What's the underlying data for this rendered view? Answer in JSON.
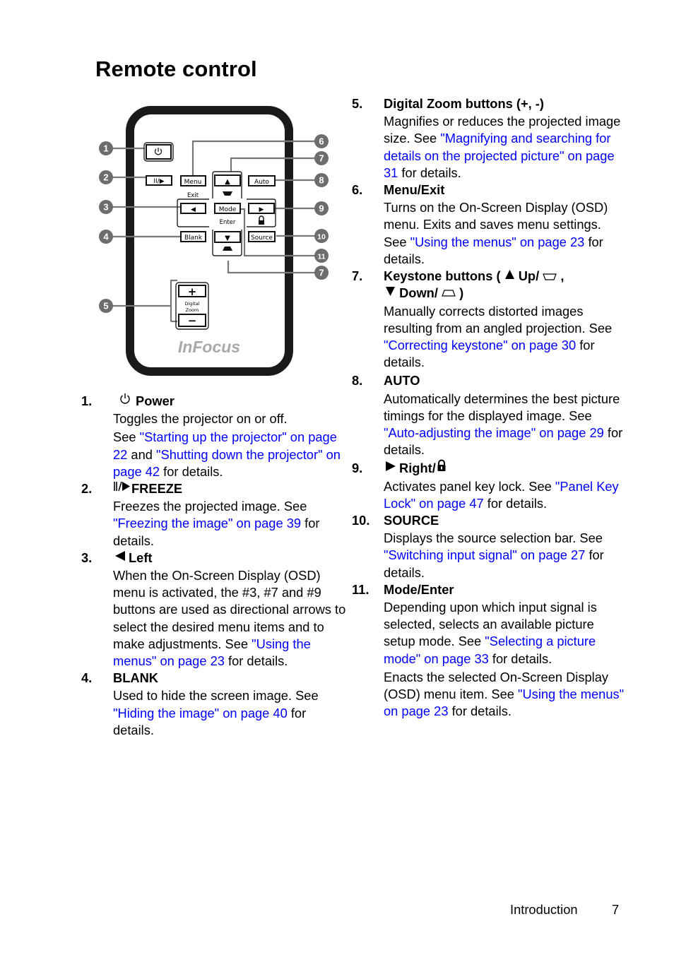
{
  "page": {
    "title": "Remote control",
    "footer": {
      "section": "Introduction",
      "page_number": "7"
    }
  },
  "diagram": {
    "brand": "InFocus",
    "buttons": {
      "power": "power-symbol",
      "freeze": "II/▶",
      "menu": "Menu",
      "exit": "Exit",
      "up": "▲",
      "auto": "Auto",
      "left": "◀",
      "mode": "Mode",
      "enter": "Enter",
      "right": "▶",
      "blank": "Blank",
      "down": "▼",
      "source": "Source",
      "zoom_in": "+",
      "zoom_label_1": "Digital",
      "zoom_label_2": "Zoom",
      "zoom_out": "−"
    },
    "callouts": [
      "1",
      "2",
      "3",
      "4",
      "5",
      "6",
      "7",
      "8",
      "9",
      "10",
      "11",
      "7"
    ],
    "colors": {
      "body": "#1a1a1a",
      "callout": "#6d6d6d",
      "brand": "#a9a9a9"
    }
  },
  "items": [
    {
      "number": "1.",
      "icon": "power-icon",
      "heading": "Power",
      "paragraphs": [
        {
          "parts": [
            {
              "text": "Toggles the projector on or off."
            }
          ]
        },
        {
          "parts": [
            {
              "text": "See "
            },
            {
              "text": "\"Starting up the projector\" on page 22",
              "link": true
            },
            {
              "text": " and "
            },
            {
              "text": "\"Shutting down the projector\" on page 42",
              "link": true
            },
            {
              "text": " for details."
            }
          ]
        }
      ]
    },
    {
      "number": "2.",
      "icon": "freeze-icon",
      "heading": "FREEZE",
      "paragraphs": [
        {
          "parts": [
            {
              "text": "Freezes the projected image. See "
            },
            {
              "text": "\"Freezing the image\" on page 39",
              "link": true
            },
            {
              "text": " for details."
            }
          ]
        }
      ]
    },
    {
      "number": "3.",
      "icon": "left-arrow-icon",
      "heading": "Left",
      "paragraphs": [
        {
          "parts": [
            {
              "text": "When the On-Screen Display (OSD) menu is activated, the #3, #7 and #9 buttons are used as directional arrows to select the desired menu items and to make adjustments. See "
            },
            {
              "text": "\"Using the menus\" on page 23",
              "link": true
            },
            {
              "text": " for details."
            }
          ]
        }
      ]
    },
    {
      "number": "4.",
      "heading": "BLANK",
      "paragraphs": [
        {
          "parts": [
            {
              "text": "Used to hide the screen image. See "
            },
            {
              "text": "\"Hiding the image\" on page 40",
              "link": true
            },
            {
              "text": " for details."
            }
          ]
        }
      ]
    },
    {
      "number": "5.",
      "heading": "Digital Zoom buttons (+, -)",
      "paragraphs": [
        {
          "parts": [
            {
              "text": "Magnifies or reduces the projected image size. See "
            },
            {
              "text": "\"Magnifying and searching for details on the projected picture\" on page 31",
              "link": true
            },
            {
              "text": " for details."
            }
          ]
        }
      ]
    },
    {
      "number": "6.",
      "heading": "Menu/Exit",
      "paragraphs": [
        {
          "parts": [
            {
              "text": "Turns on the On-Screen Display (OSD) menu. Exits and saves menu settings. See "
            },
            {
              "text": "\"Using the menus\" on page 23",
              "link": true
            },
            {
              "text": " for details."
            }
          ]
        }
      ]
    },
    {
      "number": "7.",
      "heading_parts": [
        "Keystone buttons (",
        "Up/",
        ",",
        "Down/",
        ")"
      ],
      "heading_icons": [
        "up-arrow-icon",
        "keystone-up-icon",
        "down-arrow-icon",
        "keystone-down-icon"
      ],
      "paragraphs": [
        {
          "parts": [
            {
              "text": "Manually corrects distorted images resulting from an angled projection. See "
            },
            {
              "text": "\"Correcting keystone\" on page 30",
              "link": true
            },
            {
              "text": " for details."
            }
          ]
        }
      ]
    },
    {
      "number": "8.",
      "heading": "AUTO",
      "paragraphs": [
        {
          "parts": [
            {
              "text": "Automatically determines the best picture timings for the displayed image. See "
            },
            {
              "text": "\"Auto-adjusting the image\" on page 29",
              "link": true
            },
            {
              "text": " for details."
            }
          ]
        }
      ]
    },
    {
      "number": "9.",
      "icon": "right-arrow-icon",
      "heading": "Right/",
      "heading_suffix_icon": "lock-icon",
      "paragraphs": [
        {
          "parts": [
            {
              "text": "Activates panel key lock. See "
            },
            {
              "text": "\"Panel Key Lock\" on page 47",
              "link": true
            },
            {
              "text": " for details."
            }
          ]
        }
      ]
    },
    {
      "number": "10.",
      "heading": "SOURCE",
      "paragraphs": [
        {
          "parts": [
            {
              "text": "Displays the source selection bar. See "
            },
            {
              "text": "\"Switching input signal\" on page 27",
              "link": true
            },
            {
              "text": " for details."
            }
          ]
        }
      ]
    },
    {
      "number": "11.",
      "heading": "Mode/Enter",
      "paragraphs": [
        {
          "parts": [
            {
              "text": "Depending upon which input signal is selected, selects an available picture setup mode. See "
            },
            {
              "text": "\"Selecting a picture mode\" on page 33",
              "link": true
            },
            {
              "text": " for details."
            }
          ]
        },
        {
          "parts": [
            {
              "text": "Enacts the selected On-Screen Display (OSD) menu item. See "
            },
            {
              "text": "\"Using the menus\" on page 23",
              "link": true
            },
            {
              "text": " for details."
            }
          ]
        }
      ]
    }
  ]
}
